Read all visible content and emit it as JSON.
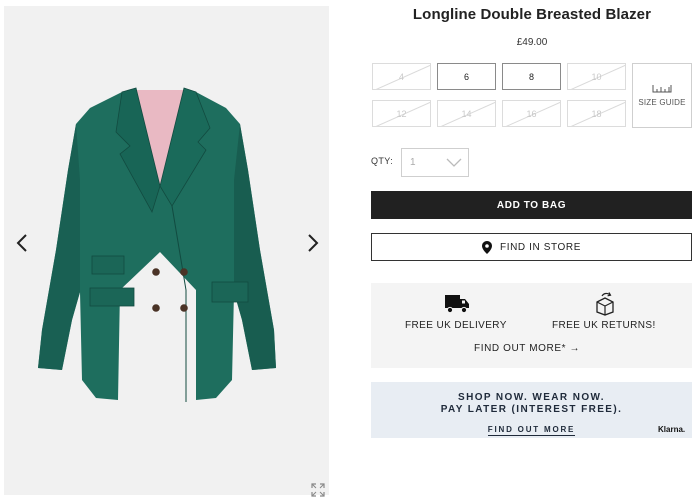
{
  "product": {
    "title": "Longline Double Breasted Blazer",
    "price": "£49.00",
    "image_alt": "Green longline double breasted blazer"
  },
  "sizes": [
    {
      "label": "4",
      "available": false
    },
    {
      "label": "6",
      "available": true
    },
    {
      "label": "8",
      "available": true
    },
    {
      "label": "10",
      "available": false
    },
    {
      "label": "12",
      "available": false
    },
    {
      "label": "14",
      "available": false
    },
    {
      "label": "16",
      "available": false
    },
    {
      "label": "18",
      "available": false
    }
  ],
  "size_guide": {
    "label": "SIZE GUIDE",
    "icon": "ruler-icon"
  },
  "quantity": {
    "label": "QTY:",
    "value": "1",
    "icon": "chevron-down-icon"
  },
  "buttons": {
    "add_to_bag": "ADD TO BAG",
    "find_in_store": "FIND IN STORE",
    "find_in_store_icon": "location-pin-icon"
  },
  "delivery": {
    "free_delivery": "FREE UK DELIVERY",
    "free_returns": "FREE UK RETURNS!",
    "find_out_more": "FIND OUT MORE* →",
    "delivery_icon": "delivery-van-icon",
    "returns_icon": "return-box-icon"
  },
  "klarna": {
    "line1": "SHOP NOW. WEAR NOW.",
    "line2": "PAY LATER (INTEREST FREE).",
    "link": "FIND OUT MORE",
    "logo": "Klarna."
  },
  "colors": {
    "jacket": "#1e6e5e",
    "button_dark": "#212121",
    "klarna_bg": "#e8edf3",
    "delivery_bg": "#f4f4f4"
  }
}
